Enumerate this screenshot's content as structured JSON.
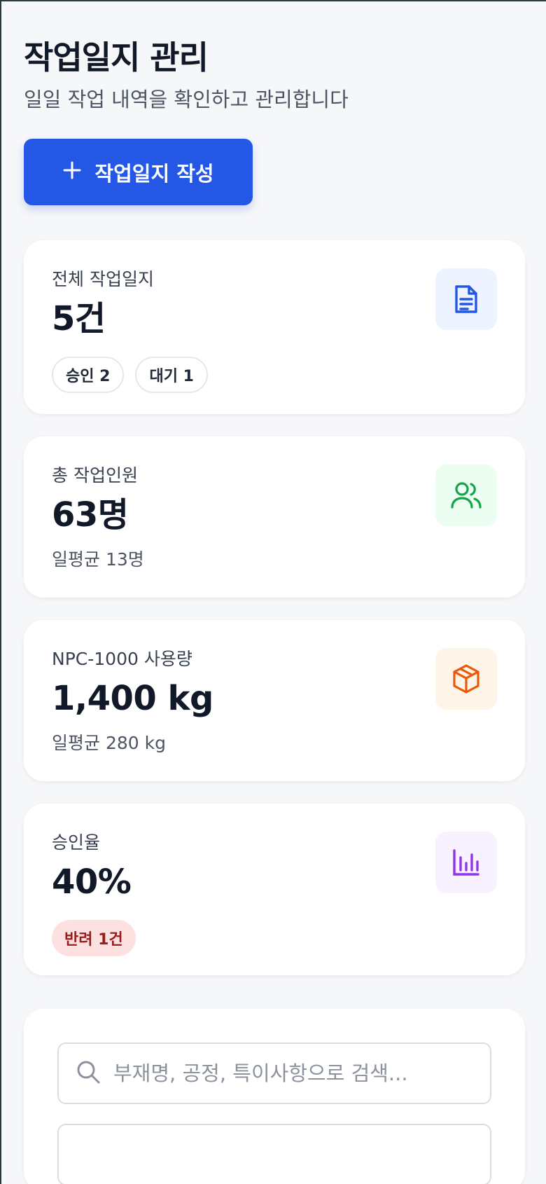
{
  "header": {
    "title": "작업일지 관리",
    "subtitle": "일일 작업 내역을 확인하고 관리합니다",
    "create_button_label": "작업일지 작성"
  },
  "stats": {
    "total_logs": {
      "label": "전체 작업일지",
      "value": "5건",
      "icon": "document-icon",
      "icon_color": "#2457e6",
      "icon_bg": "#eef4ff",
      "chips": [
        "승인 2",
        "대기 1"
      ]
    },
    "workers": {
      "label": "총 작업인원",
      "value": "63명",
      "sub": "일평균 13명",
      "icon": "users-icon",
      "icon_color": "#16a34a",
      "icon_bg": "#ecfdf1"
    },
    "npc": {
      "label": "NPC-1000 사용량",
      "value": "1,400 kg",
      "sub": "일평균 280 kg",
      "icon": "package-icon",
      "icon_color": "#ea580c",
      "icon_bg": "#fff4e8"
    },
    "approval": {
      "label": "승인율",
      "value": "40%",
      "chip": "반려 1건",
      "icon": "bar-chart-icon",
      "icon_color": "#9333ea",
      "icon_bg": "#f8f1ff"
    }
  },
  "search": {
    "placeholder": "부재명, 공정, 특이사항으로 검색...",
    "value": ""
  }
}
